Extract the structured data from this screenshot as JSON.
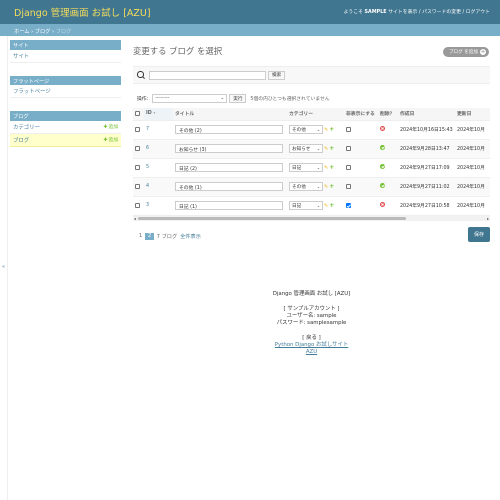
{
  "header": {
    "branding": "Django 管理画面 お試し [AZU]",
    "welcome": "ようこそ",
    "username": "SAMPLE",
    "links": [
      "サイトを表示",
      "パスワードの変更",
      "ログアウト"
    ]
  },
  "breadcrumbs": [
    "ホーム",
    "ブログ",
    "ブログ"
  ],
  "sidebar": {
    "modules": [
      {
        "caption": "サイト",
        "items": [
          {
            "label": "サイト",
            "add": ""
          }
        ]
      },
      {
        "caption": "フラットページ",
        "items": [
          {
            "label": "フラットページ",
            "add": ""
          }
        ]
      },
      {
        "caption": "ブログ",
        "items": [
          {
            "label": "カテゴリー",
            "add": "追加"
          },
          {
            "label": "ブログ",
            "add": "追加"
          }
        ]
      }
    ]
  },
  "sidebar_toggle": "«",
  "content": {
    "title": "変更する ブログ を選択",
    "add_button": "ブログ を追加",
    "add_symbol": "+"
  },
  "search": {
    "button": "検索",
    "placeholder": ""
  },
  "actions": {
    "label": "操作:",
    "selected": "---------",
    "run": "実行",
    "count": "5個の内ひとつも選択されていません"
  },
  "table": {
    "headers": [
      "ID",
      "タイトル",
      "カテゴリー",
      "非表示にする",
      "削除？",
      "作成日",
      "更新日"
    ],
    "rows": [
      {
        "id": "7",
        "title": "その他 (2)",
        "category": "その他",
        "hidden": false,
        "deleted": false,
        "created": "2024年10月16日15:43",
        "updated": "2024年10月"
      },
      {
        "id": "6",
        "title": "お知らせ (3)",
        "category": "お知らせ",
        "hidden": false,
        "deleted": true,
        "created": "2024年9月28日13:47",
        "updated": "2024年10月"
      },
      {
        "id": "5",
        "title": "日記 (2)",
        "category": "日記",
        "hidden": false,
        "deleted": true,
        "created": "2024年9月27日17:09",
        "updated": "2024年10月"
      },
      {
        "id": "4",
        "title": "その他 (1)",
        "category": "その他",
        "hidden": false,
        "deleted": true,
        "created": "2024年9月27日11:02",
        "updated": "2024年10月"
      },
      {
        "id": "3",
        "title": "日記 (1)",
        "category": "日記",
        "hidden": true,
        "deleted": false,
        "created": "2024年9月27日10:58",
        "updated": "2024年10月"
      }
    ]
  },
  "scrollbar": {
    "left": "◂",
    "right": "▸",
    "position": 0
  },
  "paginator": {
    "page1": "1",
    "current": "2",
    "count": "7 ブログ",
    "show_all": "全件表示",
    "save": "保存"
  },
  "footer": {
    "line1": "Django 管理画面 お試し [AZU]",
    "line2": "[ サンプルアカウント ]",
    "line3": "ユーザー名: sample",
    "line4": "パスワード: samplesample",
    "line5": "[ 戻る ]",
    "link1": "Python Django お試しサイト",
    "link2": "AZU"
  },
  "colors": {
    "header_bg": "#417690",
    "branding": "#f5dd5d",
    "breadcrumb_bg": "#79aec8",
    "link": "#447e9b",
    "add_green": "#70bf2b",
    "delete_red": "#dd4646",
    "highlight": "#ffffcc"
  }
}
